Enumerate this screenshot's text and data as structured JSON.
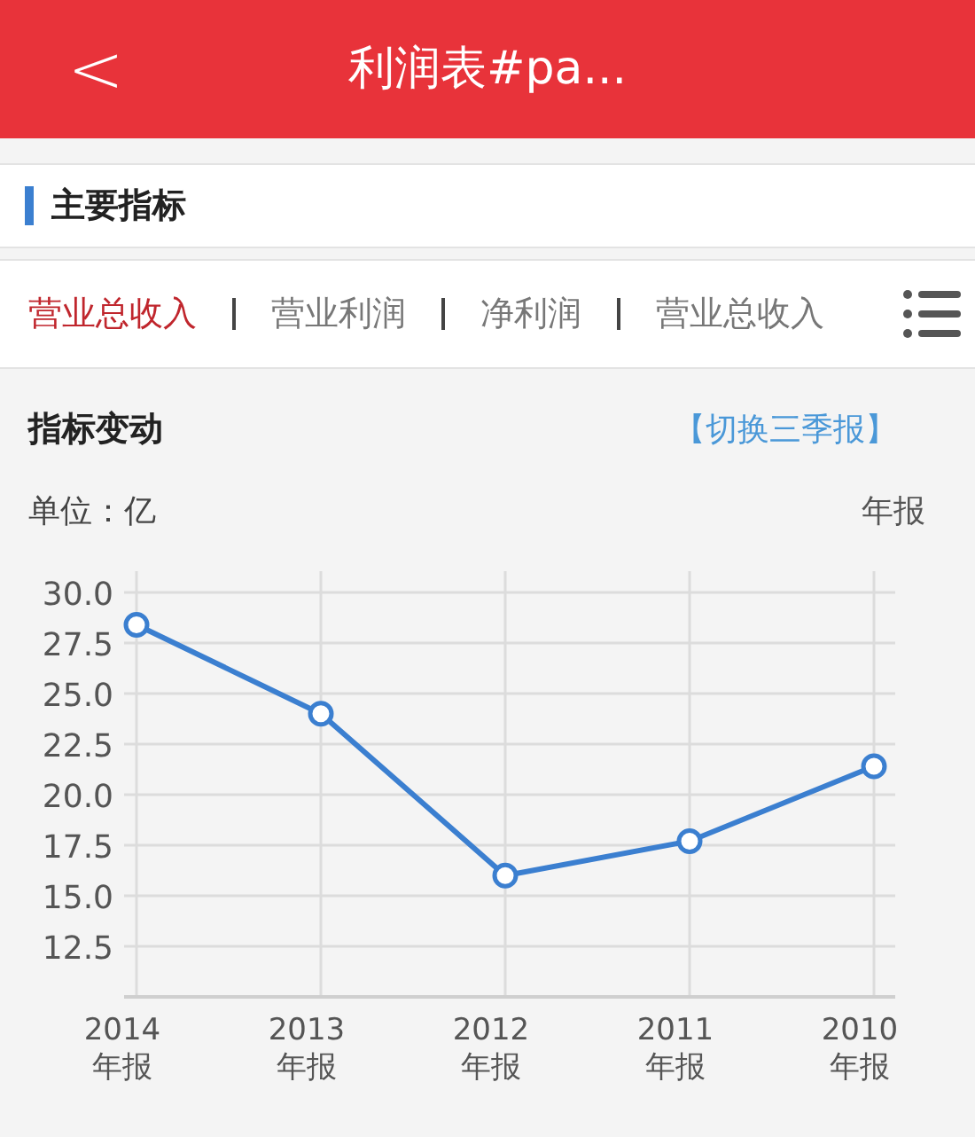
{
  "header": {
    "back_icon": "<",
    "title": "利润表#pa..."
  },
  "section": {
    "title": "主要指标"
  },
  "tabs": [
    {
      "label": "营业总收入",
      "selected": true
    },
    {
      "label": "营业利润",
      "selected": false
    },
    {
      "label": "净利润",
      "selected": false
    },
    {
      "label": "营业总收入",
      "selected": false
    }
  ],
  "indicator": {
    "title": "指标变动",
    "switch_link": "【切换三季报】",
    "unit": "单位：亿",
    "period": "年报",
    "chart_data": {
      "type": "line",
      "categories": [
        "2014\n年报",
        "2013\n年报",
        "2012\n年报",
        "2011\n年报",
        "2010\n年报"
      ],
      "series": [
        {
          "color": "#3b7fd0",
          "marker": true,
          "values": [
            28.4,
            24.0,
            16.0,
            17.7,
            21.4
          ]
        }
      ],
      "grid": true,
      "ylim": [
        10,
        30
      ],
      "yticks": [
        {
          "value": 30,
          "label": "30.0"
        },
        {
          "value": 27.5,
          "label": "27.5"
        },
        {
          "value": 25,
          "label": "25.0"
        },
        {
          "value": 22.5,
          "label": "22.5"
        },
        {
          "value": 20,
          "label": "20.0"
        },
        {
          "value": 17.5,
          "label": "17.5"
        },
        {
          "value": 15,
          "label": "15.0"
        },
        {
          "value": 12.5,
          "label": "12.5"
        }
      ]
    }
  }
}
